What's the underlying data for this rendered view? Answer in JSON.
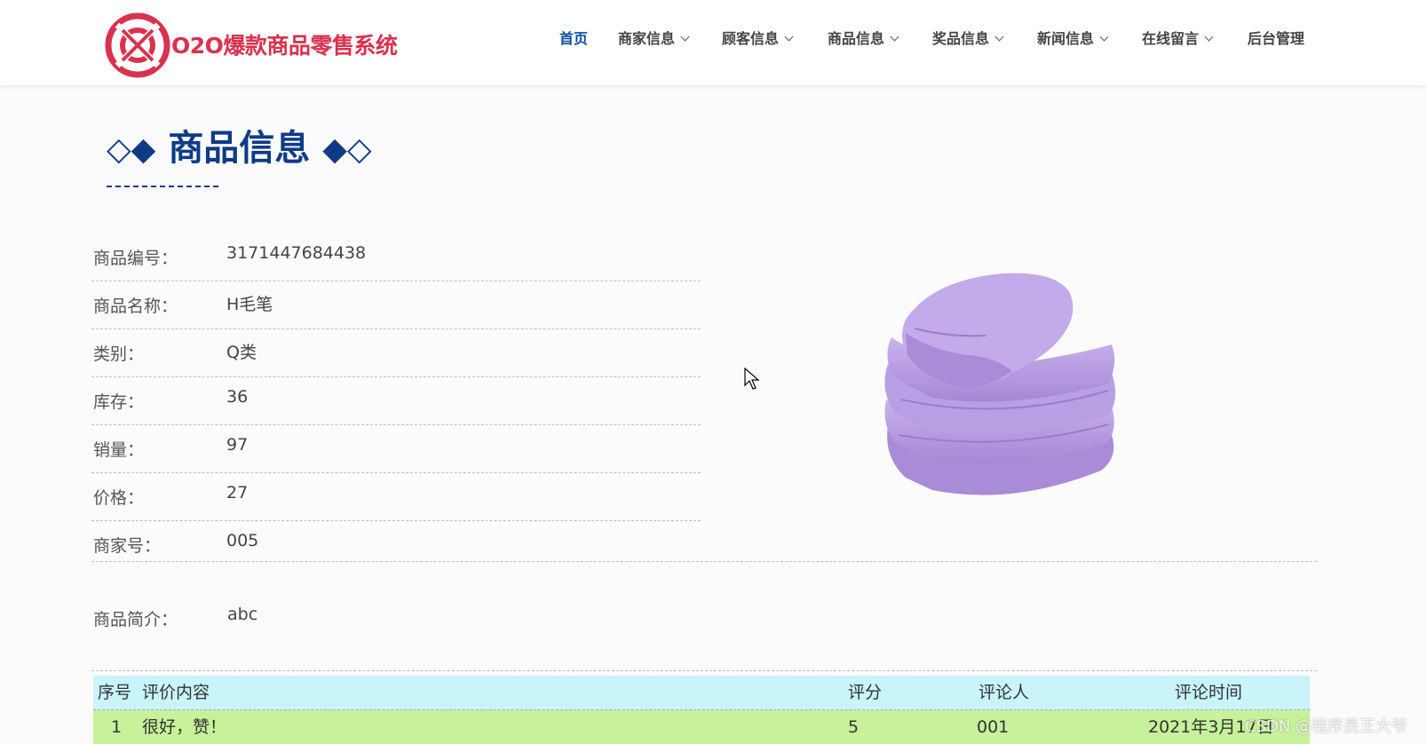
{
  "header": {
    "brand": "O2O爆款商品零售系统",
    "nav": [
      {
        "label": "首页",
        "has_dropdown": false,
        "active": true
      },
      {
        "label": "商家信息",
        "has_dropdown": true,
        "active": false
      },
      {
        "label": "顾客信息",
        "has_dropdown": true,
        "active": false
      },
      {
        "label": "商品信息",
        "has_dropdown": true,
        "active": false
      },
      {
        "label": "奖品信息",
        "has_dropdown": true,
        "active": false
      },
      {
        "label": "新闻信息",
        "has_dropdown": true,
        "active": false
      },
      {
        "label": "在线留言",
        "has_dropdown": true,
        "active": false
      },
      {
        "label": "后台管理",
        "has_dropdown": false,
        "active": false
      }
    ]
  },
  "section": {
    "title_left": "◇◆",
    "title": "商品信息",
    "title_right": "◆◇"
  },
  "details": [
    {
      "label": "商品编号：",
      "value": "3171447684438"
    },
    {
      "label": "商品名称：",
      "value": "H毛笔"
    },
    {
      "label": "类别：",
      "value": "Q类"
    },
    {
      "label": "库存：",
      "value": "36"
    },
    {
      "label": "销量：",
      "value": "97"
    },
    {
      "label": "价格：",
      "value": "27"
    },
    {
      "label": "商家号：",
      "value": "005"
    }
  ],
  "intro": {
    "label": "商品简介：",
    "value": "abc"
  },
  "reviews": {
    "headers": [
      "序号",
      "评价内容",
      "评分",
      "评论人",
      "评论时间"
    ],
    "rows": [
      [
        "1",
        "很好，赞！",
        "5",
        "001",
        "2021年3月17日"
      ]
    ]
  },
  "watermark": "CSDN @程序员王大爷",
  "colors": {
    "accent": "#0c4aa0",
    "brand": "#d8324f",
    "table_head": "#c9f4fa",
    "table_row": "#c7f19a",
    "product": "#b89be0"
  }
}
